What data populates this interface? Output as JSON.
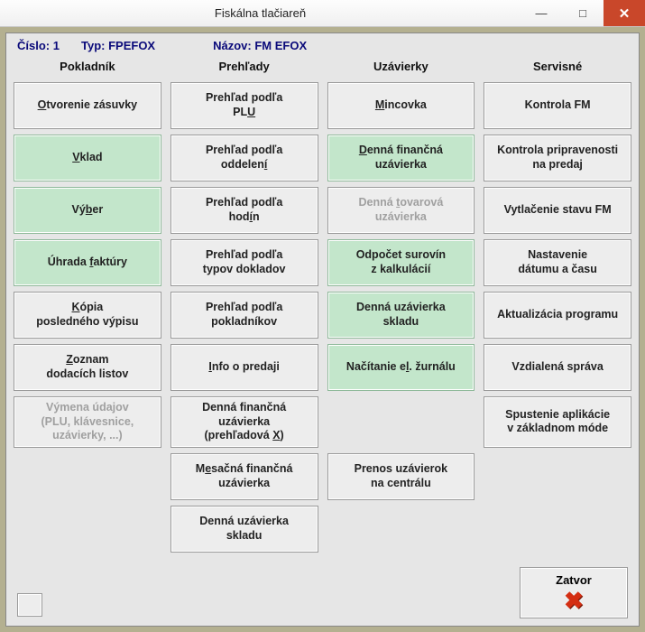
{
  "window": {
    "title": "Fiskálna tlačiareň",
    "min": "—",
    "max": "□",
    "close": "✕"
  },
  "info": {
    "cislo_label": "Číslo:",
    "cislo_value": "1",
    "typ_label": "Typ:",
    "typ_value": "FPEFOX",
    "nazov_label": "Názov:",
    "nazov_value": "FM EFOX"
  },
  "columns": [
    "Pokladník",
    "Prehľady",
    "Uzávierky",
    "Servisné"
  ],
  "col1": [
    {
      "pre": "",
      "u": "O",
      "post": "tvorenie zásuvky",
      "green": false,
      "disabled": false
    },
    {
      "pre": "",
      "u": "V",
      "post": "klad",
      "green": true,
      "disabled": false
    },
    {
      "pre": "Vý",
      "u": "b",
      "post": "er",
      "green": true,
      "disabled": false
    },
    {
      "pre": "Úhrada ",
      "u": "f",
      "post": "aktúry",
      "green": true,
      "disabled": false
    },
    {
      "pre": "",
      "u": "K",
      "post": "ópia\nposledného výpisu",
      "green": false,
      "disabled": false
    },
    {
      "pre": "",
      "u": "Z",
      "post": "oznam\ndodacích listov",
      "green": false,
      "disabled": false
    },
    {
      "pre": "Výmena údajov\n(PLU, klávesnice,\nuzávierky, ...)",
      "u": "",
      "post": "",
      "green": false,
      "disabled": true
    }
  ],
  "col2": [
    {
      "pre": "Prehľad podľa\nPL",
      "u": "U",
      "post": "",
      "green": false,
      "disabled": false
    },
    {
      "pre": "Prehľad podľa\noddelen",
      "u": "í",
      "post": "",
      "green": false,
      "disabled": false
    },
    {
      "pre": "Prehľad podľa\nhod",
      "u": "í",
      "post": "n",
      "green": false,
      "disabled": false
    },
    {
      "pre": "Prehľad podľa\ntypov dokladov",
      "u": "",
      "post": "",
      "green": false,
      "disabled": false
    },
    {
      "pre": "Prehľad podľa\npokladníkov",
      "u": "",
      "post": "",
      "green": false,
      "disabled": false
    },
    {
      "pre": "",
      "u": "I",
      "post": "nfo o predaji",
      "green": false,
      "disabled": false
    },
    {
      "pre": "Denná finančná\nuzávierka\n(prehľadová ",
      "u": "X",
      "post": ")",
      "green": false,
      "disabled": false
    },
    {
      "pre": "M",
      "u": "e",
      "post": "sačná finančná\nuzávierka",
      "green": false,
      "disabled": false
    },
    {
      "pre": "Denná uzávierka\nskladu",
      "u": "",
      "post": "",
      "green": false,
      "disabled": false
    }
  ],
  "col3": [
    {
      "pre": "",
      "u": "M",
      "post": "incovka",
      "green": false,
      "disabled": false
    },
    {
      "pre": "",
      "u": "D",
      "post": "enná finančná\nuzávierka",
      "green": true,
      "disabled": false
    },
    {
      "pre": "Denná ",
      "u": "t",
      "post": "ovarová\nuzávierka",
      "green": false,
      "disabled": true
    },
    {
      "pre": "Odpočet surovín\nz kalkulácií",
      "u": "",
      "post": "",
      "green": true,
      "disabled": false
    },
    {
      "pre": "Denná uzávierka\nskladu",
      "u": "",
      "post": "",
      "green": true,
      "disabled": false
    },
    {
      "pre": "Načítanie e",
      "u": "l",
      "post": ". žurnálu",
      "green": true,
      "disabled": false
    },
    {
      "pre": "",
      "u": "",
      "post": "",
      "green": false,
      "disabled": false,
      "empty": true
    },
    {
      "pre": "Prenos uzávierok\nna centrálu",
      "u": "",
      "post": "",
      "green": false,
      "disabled": false
    }
  ],
  "col4": [
    {
      "pre": "Kontrola FM",
      "u": "",
      "post": "",
      "green": false,
      "disabled": false
    },
    {
      "pre": "Kontrola pripravenosti\nna predaj",
      "u": "",
      "post": "",
      "green": false,
      "disabled": false
    },
    {
      "pre": "Vytlačenie stavu FM",
      "u": "",
      "post": "",
      "green": false,
      "disabled": false
    },
    {
      "pre": "Nastavenie\ndátumu a času",
      "u": "",
      "post": "",
      "green": false,
      "disabled": false
    },
    {
      "pre": "Aktualizácia programu",
      "u": "",
      "post": "",
      "green": false,
      "disabled": false
    },
    {
      "pre": "Vzdialená správa",
      "u": "",
      "post": "",
      "green": false,
      "disabled": false
    },
    {
      "pre": "Spustenie aplikácie\nv základnom móde",
      "u": "",
      "post": "",
      "green": false,
      "disabled": false
    }
  ],
  "close_label": "Zatvor"
}
